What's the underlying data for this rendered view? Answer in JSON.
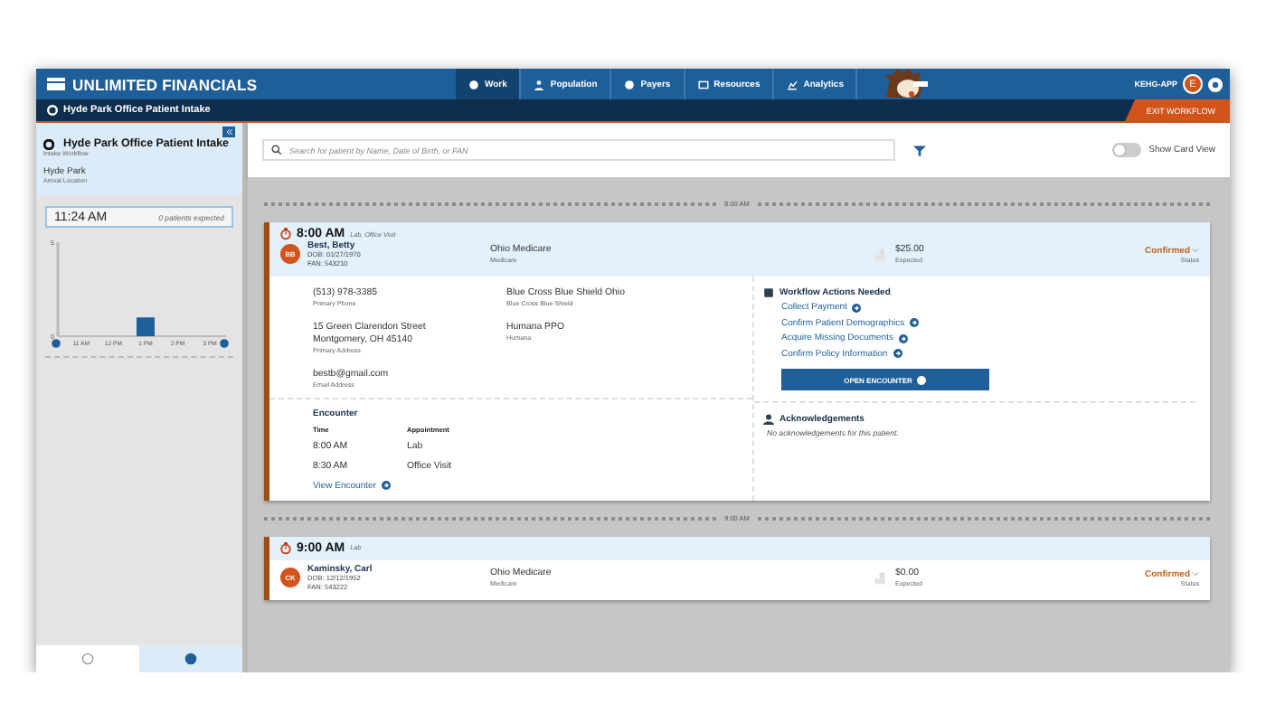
{
  "app": {
    "title": "UNLIMITED FINANCIALS",
    "nav": [
      {
        "label": "Work",
        "selected": true
      },
      {
        "label": "Population",
        "selected": false
      },
      {
        "label": "Payers",
        "selected": false
      },
      {
        "label": "Resources",
        "selected": false
      },
      {
        "label": "Analytics",
        "selected": false
      }
    ],
    "user": {
      "name": "KEHG-APP",
      "initial": "E"
    }
  },
  "workflow_bar": {
    "title": "Hyde Park Office Patient Intake",
    "exit": "EXIT WORKFLOW"
  },
  "sidebar": {
    "title": "Hyde Park Office Patient Intake",
    "subtitle": "Intake Workflow",
    "location": "Hyde Park",
    "location_label": "Arrival Location",
    "time": "11:24 AM",
    "expected": "0 patients expected",
    "chart_data": {
      "type": "bar",
      "categories": [
        "11 AM",
        "12 PM",
        "1 PM",
        "2 PM",
        "3 PM"
      ],
      "values": [
        0,
        0,
        1,
        0,
        0
      ],
      "ylim": [
        0,
        5
      ],
      "yticks": [
        0,
        5
      ]
    },
    "bottom_tabs": [
      {
        "selected": false
      },
      {
        "selected": true
      }
    ]
  },
  "search": {
    "placeholder": "Search for patient by Name, Date of Birth, or FAN"
  },
  "card_view": {
    "label": "Show Card View",
    "on": false
  },
  "groups": [
    {
      "time": "8:00 AM",
      "card": {
        "time": "8:00 AM",
        "types": "Lab, Office Visit",
        "initials": "BB",
        "name": "Best, Betty",
        "dob": "DOB: 01/27/1970",
        "fan": "FAN: 543210",
        "insurance": "Ohio Medicare",
        "insurance_type": "Medicare",
        "amount": "$25.00",
        "amount_label": "Expected",
        "status": "Confirmed",
        "status_label": "Status",
        "expanded": true,
        "details": {
          "fields": [
            {
              "lines": [
                "(513) 978-3385"
              ],
              "label": "Primary Phone"
            },
            {
              "lines": [
                "15 Green Clarendon Street",
                "Montgomery, OH 45140"
              ],
              "label": "Primary Address"
            },
            {
              "lines": [
                "bestb@gmail.com"
              ],
              "label": "Email Address"
            }
          ],
          "policies": [
            {
              "name": "Blue Cross Blue Shield Ohio",
              "payer": "Blue Cross Blue Shield"
            },
            {
              "name": "Humana PPO",
              "payer": "Humana"
            }
          ],
          "encounter": {
            "title": "Encounter",
            "columns": [
              "Time",
              "Appointment"
            ],
            "rows": [
              [
                "8:00 AM",
                "Lab"
              ],
              [
                "8:30 AM",
                "Office Visit"
              ]
            ],
            "link": "View Encounter"
          },
          "actions": {
            "title": "Workflow Actions Needed",
            "items": [
              "Collect Payment",
              "Confirm Patient Demographics",
              "Acquire Missing Documents",
              "Confirm Policy Information"
            ],
            "button": "OPEN ENCOUNTER"
          },
          "acknowledgements": {
            "title": "Acknowledgements",
            "empty": "No acknowledgements for this patient."
          }
        }
      }
    },
    {
      "time": "9:00 AM",
      "card": {
        "time": "9:00 AM",
        "types": "Lab",
        "initials": "CK",
        "name": "Kaminsky, Carl",
        "dob": "DOB: 12/12/1952",
        "fan": "FAN: 543222",
        "insurance": "Ohio Medicare",
        "insurance_type": "Medicare",
        "amount": "$0.00",
        "amount_label": "Expected",
        "status": "Confirmed",
        "status_label": "Status",
        "expanded": false
      }
    }
  ]
}
